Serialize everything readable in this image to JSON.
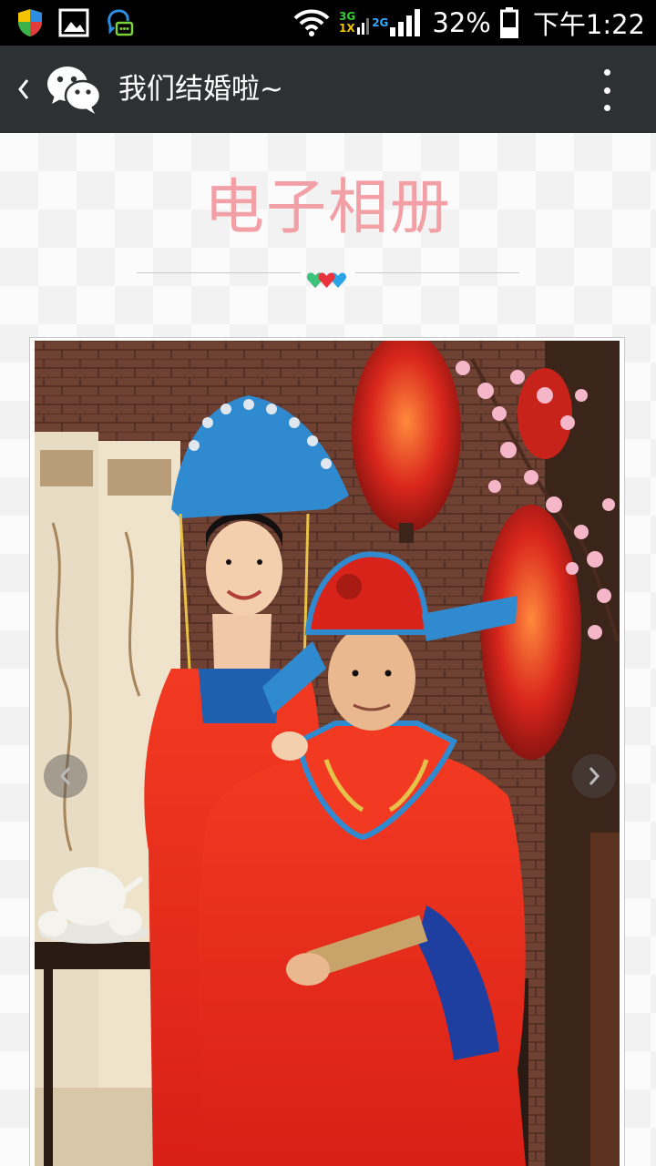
{
  "status_bar": {
    "icons": [
      "shield-icon",
      "gallery-icon",
      "assistant-chat-icon"
    ],
    "network": {
      "top_label": "3G",
      "bottom_label": "1X",
      "second_label": "2G"
    },
    "battery_percent": "32%",
    "time": "下午1:22"
  },
  "title_bar": {
    "back_icon": "chevron-left-icon",
    "logo_icon": "wechat-icon",
    "title": "我们结婚啦~",
    "menu_icon": "more-vertical-icon"
  },
  "album": {
    "heading": "电子相册",
    "heart_colors": [
      "#3cc47c",
      "#e8323c",
      "#2aa6e8"
    ],
    "prev_icon": "chevron-left-icon",
    "next_icon": "chevron-right-icon"
  },
  "colors": {
    "status_bar_bg": "#000000",
    "title_bar_bg": "#2e3132",
    "heading_pink": "#f2a0a6"
  }
}
